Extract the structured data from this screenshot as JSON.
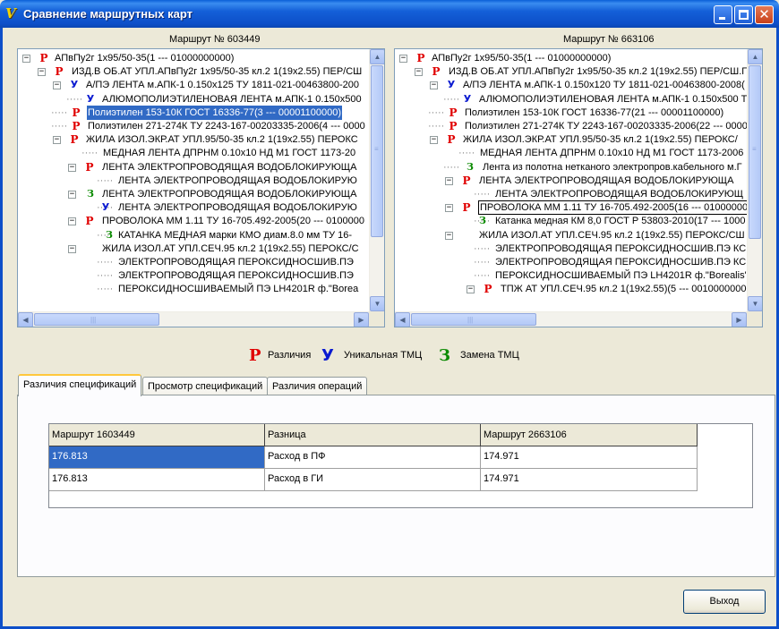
{
  "window": {
    "title": "Сравнение маршрутных карт",
    "icon_glyph": "V",
    "icon": "app-logo-icon",
    "minimize_glyph": "",
    "close_glyph": "✕"
  },
  "left_panel": {
    "label": "Маршрут № 603449",
    "rows": [
      {
        "expander": "−",
        "icon": "p",
        "icon_glyph": "P",
        "text": "АПвПу2г 1х95/50-35(1 --- 01000000000)"
      },
      {
        "expander": "−",
        "icon": "p",
        "icon_glyph": "P",
        "text": "ИЗД.В ОБ.АТ УПЛ.АПвПу2г 1х95/50-35 кл.2 1(19х2.55) ПЕР/СШ"
      },
      {
        "expander": "−",
        "icon": "u",
        "icon_glyph": "У",
        "text": "А/ПЭ ЛЕНТА м.АПК-1 0.150х125 ТУ 1811-021-00463800-200"
      },
      {
        "expander": "",
        "icon": "u",
        "icon_glyph": "У",
        "text": "АЛЮМОПОЛИЭТИЛЕНОВАЯ ЛЕНТА м.АПК-1 0.150х500"
      },
      {
        "expander": "",
        "icon": "p",
        "icon_glyph": "P",
        "text": "Полиэтилен 153-10К ГОСТ 16336-77(3 --- 00001100000)"
      },
      {
        "expander": "",
        "icon": "p",
        "icon_glyph": "P",
        "text": "Полиэтилен 271-274К ТУ 2243-167-00203335-2006(4 --- 0000"
      },
      {
        "expander": "−",
        "icon": "p",
        "icon_glyph": "P",
        "text": "ЖИЛА ИЗОЛ.ЭКР.АТ УПЛ.95/50-35 кл.2 1(19х2.55) ПЕРОКС"
      },
      {
        "expander": "",
        "icon": "",
        "icon_glyph": "",
        "text": "МЕДНАЯ ЛЕНТА ДПРНМ 0.10х10 НД М1 ГОСТ 1173-20"
      },
      {
        "expander": "−",
        "icon": "p",
        "icon_glyph": "P",
        "text": "ЛЕНТА ЭЛЕКТРОПРОВОДЯЩАЯ ВОДОБЛОКИРУЮЩА"
      },
      {
        "expander": "",
        "icon": "",
        "icon_glyph": "",
        "text": "ЛЕНТА ЭЛЕКТРОПРОВОДЯЩАЯ ВОДОБЛОКИРУЮ"
      },
      {
        "expander": "−",
        "icon": "z",
        "icon_glyph": "З",
        "text": "ЛЕНТА ЭЛЕКТРОПРОВОДЯЩАЯ ВОДОБЛОКИРУЮЩА"
      },
      {
        "expander": "",
        "icon": "u",
        "icon_glyph": "У",
        "text": "ЛЕНТА ЭЛЕКТРОПРОВОДЯЩАЯ ВОДОБЛОКИРУЮ"
      },
      {
        "expander": "−",
        "icon": "p",
        "icon_glyph": "P",
        "text": "ПРОВОЛОКА ММ 1.11 ТУ 16-705.492-2005(20 --- 0100000"
      },
      {
        "expander": "",
        "icon": "z",
        "icon_glyph": "З",
        "text": "КАТАНКА МЕДНАЯ марки КМО диам.8.0 мм ТУ 16-"
      },
      {
        "expander": "−",
        "icon": "",
        "icon_glyph": "",
        "text": "ЖИЛА ИЗОЛ.АТ УПЛ.СЕЧ.95 кл.2 1(19х2.55) ПЕРОКС/С"
      },
      {
        "expander": "",
        "icon": "",
        "icon_glyph": "",
        "text": "ЭЛЕКТРОПРОВОДЯЩАЯ ПЕРОКСИДНОСШИВ.ПЭ"
      },
      {
        "expander": "",
        "icon": "",
        "icon_glyph": "",
        "text": "ЭЛЕКТРОПРОВОДЯЩАЯ ПЕРОКСИДНОСШИВ.ПЭ"
      },
      {
        "expander": "",
        "icon": "",
        "icon_glyph": "",
        "text": "ПЕРОКСИДНОСШИВАЕМЫЙ ПЭ LH4201R ф.\"Borea"
      }
    ]
  },
  "right_panel": {
    "label": "Маршрут № 663106",
    "rows": [
      {
        "expander": "−",
        "icon": "p",
        "icon_glyph": "P",
        "text": "АПвПу2г 1х95/50-35(1 --- 01000000000)"
      },
      {
        "expander": "−",
        "icon": "p",
        "icon_glyph": "P",
        "text": "ИЗД.В ОБ.АТ УПЛ.АПвПу2г 1х95/50-35 кл.2 1(19х2.55) ПЕР/СШ.П"
      },
      {
        "expander": "−",
        "icon": "u",
        "icon_glyph": "У",
        "text": "А/ПЭ ЛЕНТА м.АПК-1 0.150х120 ТУ 1811-021-00463800-2008("
      },
      {
        "expander": "",
        "icon": "u",
        "icon_glyph": "У",
        "text": "АЛЮМОПОЛИЭТИЛЕНОВАЯ ЛЕНТА м.АПК-1 0.150х500 Т"
      },
      {
        "expander": "",
        "icon": "p",
        "icon_glyph": "P",
        "text": "Полиэтилен 153-10К ГОСТ 16336-77(21 --- 00001100000)"
      },
      {
        "expander": "",
        "icon": "p",
        "icon_glyph": "P",
        "text": "Полиэтилен 271-274К ТУ 2243-167-00203335-2006(22 --- 00001"
      },
      {
        "expander": "−",
        "icon": "p",
        "icon_glyph": "P",
        "text": "ЖИЛА ИЗОЛ.ЭКР.АТ УПЛ.95/50-35 кл.2 1(19х2.55) ПЕРОКС/"
      },
      {
        "expander": "",
        "icon": "",
        "icon_glyph": "",
        "text": "МЕДНАЯ ЛЕНТА ДПРНМ 0.10х10 НД М1 ГОСТ 1173-2006"
      },
      {
        "expander": "",
        "icon": "z",
        "icon_glyph": "З",
        "text": "Лента из полотна нетканого электропров.кабельного м.Г"
      },
      {
        "expander": "−",
        "icon": "p",
        "icon_glyph": "P",
        "text": "ЛЕНТА ЭЛЕКТРОПРОВОДЯЩАЯ ВОДОБЛОКИРУЮЩА"
      },
      {
        "expander": "",
        "icon": "",
        "icon_glyph": "",
        "text": "ЛЕНТА ЭЛЕКТРОПРОВОДЯЩАЯ ВОДОБЛОКИРУЮЩ"
      },
      {
        "expander": "−",
        "icon": "p",
        "icon_glyph": "P",
        "text": "ПРОВОЛОКА ММ 1.11 ТУ 16-705.492-2005(16 --- 01000000000)"
      },
      {
        "expander": "",
        "icon": "z",
        "icon_glyph": "З",
        "text": "Катанка медная КМ 8,0 ГОСТ Р 53803-2010(17 --- 1000"
      },
      {
        "expander": "−",
        "icon": "",
        "icon_glyph": "",
        "text": "ЖИЛА ИЗОЛ.АТ УПЛ.СЕЧ.95 кл.2 1(19х2.55) ПЕРОКС/СШ"
      },
      {
        "expander": "",
        "icon": "",
        "icon_glyph": "",
        "text": "ЭЛЕКТРОПРОВОДЯЩАЯ ПЕРОКСИДНОСШИВ.ПЭ КС"
      },
      {
        "expander": "",
        "icon": "",
        "icon_glyph": "",
        "text": "ЭЛЕКТРОПРОВОДЯЩАЯ ПЕРОКСИДНОСШИВ.ПЭ КС"
      },
      {
        "expander": "",
        "icon": "",
        "icon_glyph": "",
        "text": "ПЕРОКСИДНОСШИВАЕМЫЙ ПЭ LH4201R ф.\"Borealis\""
      },
      {
        "expander": "−",
        "icon": "p",
        "icon_glyph": "P",
        "text": "ТПЖ АТ УПЛ.СЕЧ.95 кл.2 1(19х2.55)(5 --- 00100000000"
      }
    ]
  },
  "legend": [
    {
      "glyph": "P",
      "icon": "difference-icon",
      "label": "Различия",
      "color": "#e00000"
    },
    {
      "glyph": "У",
      "icon": "unique-icon",
      "label": "Уникальная ТМЦ",
      "color": "#0a1ad0"
    },
    {
      "glyph": "З",
      "icon": "replacement-icon",
      "label": "Замена ТМЦ",
      "color": "#0a8a00"
    }
  ],
  "tabs": [
    {
      "label": "Различия спецификаций",
      "active": true
    },
    {
      "label": "Просмотр спецификаций",
      "active": false
    },
    {
      "label": "Различия операций",
      "active": false
    }
  ],
  "grid": {
    "columns": [
      "Маршрут 1603449",
      "Разница",
      "Маршрут 2663106"
    ],
    "rows": [
      [
        "176.813",
        "Расход в ПФ",
        "174.971"
      ],
      [
        "176.813",
        "Расход в ГИ",
        "174.971"
      ]
    ]
  },
  "exit_button": "Выход",
  "scroll_glyphs": {
    "up": "▲",
    "down": "▼",
    "left": "◀",
    "right": "▶",
    "grip_v": "≡",
    "grip_h": "|||"
  }
}
